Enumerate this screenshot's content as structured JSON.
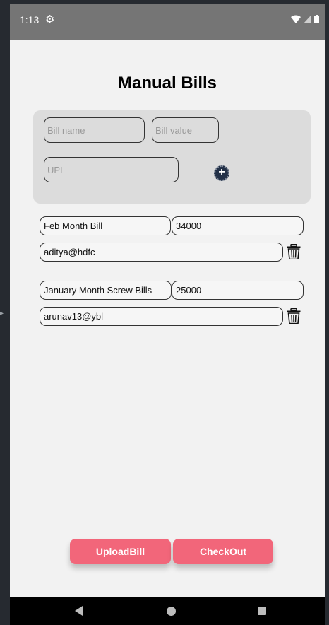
{
  "status_bar": {
    "time": "1:13"
  },
  "page": {
    "title": "Manual Bills"
  },
  "form": {
    "bill_name_placeholder": "Bill name",
    "bill_value_placeholder": "Bill value",
    "upi_placeholder": "UPI",
    "add_icon": "plus-circle-icon"
  },
  "bills": [
    {
      "name": "Feb Month Bill",
      "value": "34000",
      "upi": "aditya@hdfc"
    },
    {
      "name": "January Month Screw Bills",
      "value": "25000",
      "upi": "arunav13@ybl"
    }
  ],
  "actions": {
    "upload_label": "UploadBill",
    "checkout_label": "CheckOut"
  },
  "colors": {
    "accent": "#f2667a",
    "status_bar": "#757575",
    "card": "#dcdcdc",
    "background": "#f2f2f2"
  }
}
